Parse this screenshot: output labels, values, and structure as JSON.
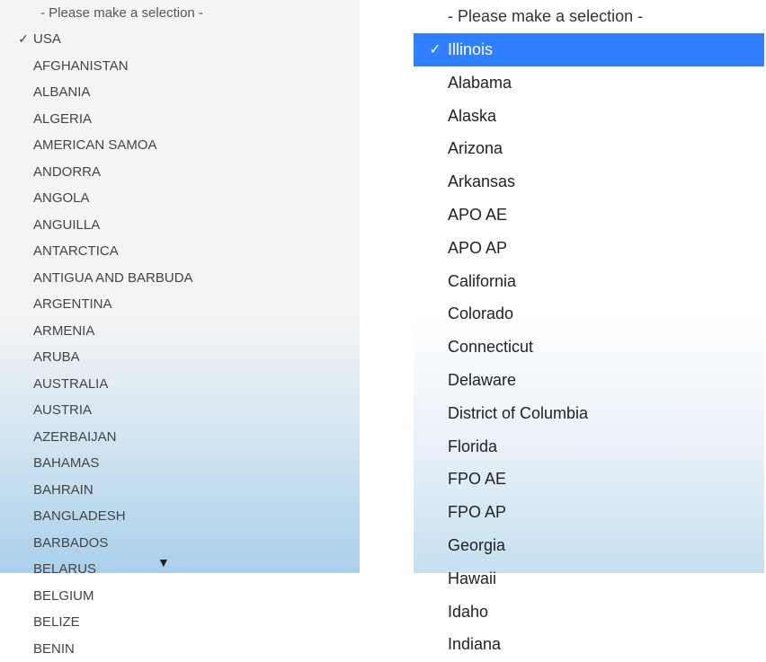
{
  "left_dropdown": {
    "placeholder": "- Please make a selection -",
    "selected_index": 0,
    "options": [
      "USA",
      "AFGHANISTAN",
      "ALBANIA",
      "ALGERIA",
      "AMERICAN SAMOA",
      "ANDORRA",
      "ANGOLA",
      "ANGUILLA",
      "ANTARCTICA",
      "ANTIGUA AND BARBUDA",
      "ARGENTINA",
      "ARMENIA",
      "ARUBA",
      "AUSTRALIA",
      "AUSTRIA",
      "AZERBAIJAN",
      "BAHAMAS",
      "BAHRAIN",
      "BANGLADESH",
      "BARBADOS",
      "BELARUS",
      "BELGIUM",
      "BELIZE",
      "BENIN"
    ],
    "scroll_indicator": "▼"
  },
  "right_dropdown": {
    "placeholder": "- Please make a selection -",
    "selected_index": 0,
    "options": [
      "Illinois",
      "Alabama",
      "Alaska",
      "Arizona",
      "Arkansas",
      "APO AE",
      "APO AP",
      "California",
      "Colorado",
      "Connecticut",
      "Delaware",
      "District of Columbia",
      "Florida",
      "FPO AE",
      "FPO AP",
      "Georgia",
      "Hawaii",
      "Idaho",
      "Indiana"
    ]
  }
}
